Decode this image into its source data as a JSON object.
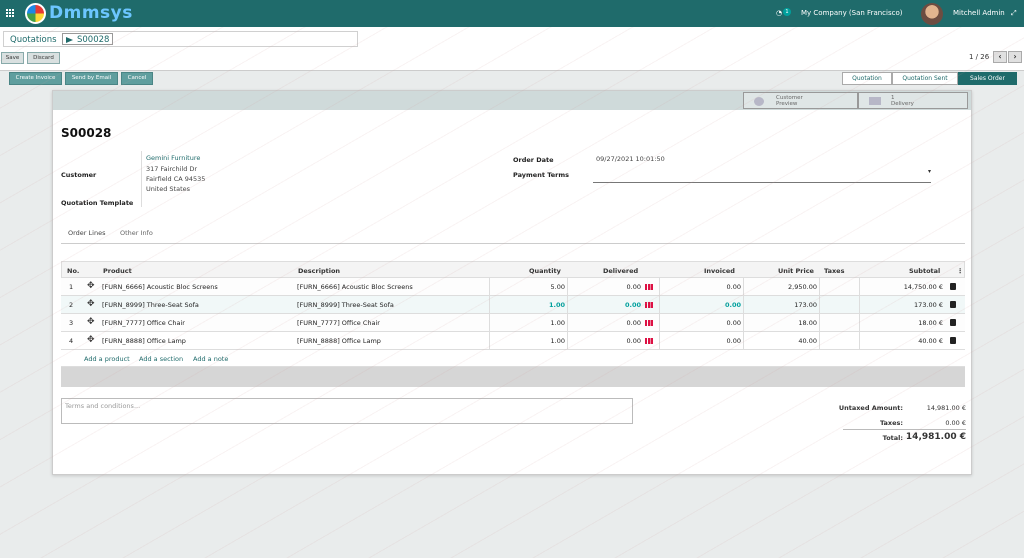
{
  "app": {
    "logo_text": "Dmmsys"
  },
  "topbar": {
    "chat_badge": "1",
    "company": "My Company (San Francisco)",
    "user": "Mitchell Admin",
    "expand_icon": "expand-icon"
  },
  "breadcrumb": {
    "parent": "Quotations",
    "current": "S00028"
  },
  "toolbar": {
    "save_label": "Save",
    "discard_label": "Discard"
  },
  "pager": {
    "text": "1 / 26"
  },
  "actions": {
    "create_invoice": "Create Invoice",
    "send_by_email": "Send by Email",
    "cancel": "Cancel"
  },
  "stages": [
    {
      "label": "Quotation",
      "active": false
    },
    {
      "label": "Quotation Sent",
      "active": false
    },
    {
      "label": "Sales Order",
      "active": true
    }
  ],
  "smart_buttons": [
    {
      "line1": "Customer",
      "line2": "Preview"
    },
    {
      "line1": "1",
      "line2": "Delivery"
    }
  ],
  "order": {
    "name": "S00028",
    "customer_label": "Customer",
    "customer_name": "Gemini Furniture",
    "address1": "317 Fairchild Dr",
    "address2": "Fairfield CA 94535",
    "address3": "United States",
    "quotation_template_label": "Quotation Template",
    "order_date_label": "Order Date",
    "order_date": "09/27/2021 10:01:50",
    "payment_terms_label": "Payment Terms"
  },
  "tabs": [
    "Order Lines",
    "Other Info"
  ],
  "table": {
    "headers": [
      "No.",
      "Product",
      "Description",
      "Quantity",
      "Delivered",
      "Invoiced",
      "Unit Price",
      "Taxes",
      "Subtotal"
    ],
    "rows": [
      {
        "no": "1",
        "product": "[FURN_6666] Acoustic Bloc Screens",
        "description": "[FURN_6666] Acoustic Bloc Screens",
        "quantity": "5.00",
        "delivered": "0.00",
        "invoiced": "0.00",
        "unit_price": "2,950.00",
        "subtotal": "14,750.00 €",
        "highlight": false
      },
      {
        "no": "2",
        "product": "[FURN_8999] Three-Seat Sofa",
        "description": "[FURN_8999] Three-Seat Sofa",
        "quantity": "1.00",
        "delivered": "0.00",
        "invoiced": "0.00",
        "unit_price": "173.00",
        "subtotal": "173.00 €",
        "highlight": true
      },
      {
        "no": "3",
        "product": "[FURN_7777] Office Chair",
        "description": "[FURN_7777] Office Chair",
        "quantity": "1.00",
        "delivered": "0.00",
        "invoiced": "0.00",
        "unit_price": "18.00",
        "subtotal": "18.00 €",
        "highlight": false
      },
      {
        "no": "4",
        "product": "[FURN_8888] Office Lamp",
        "description": "[FURN_8888] Office Lamp",
        "quantity": "1.00",
        "delivered": "0.00",
        "invoiced": "0.00",
        "unit_price": "40.00",
        "subtotal": "40.00 €",
        "highlight": false
      }
    ],
    "add_product": "Add a product",
    "add_section": "Add a section",
    "add_note": "Add a note"
  },
  "terms_placeholder": "Terms and conditions...",
  "totals": {
    "untaxed_label": "Untaxed Amount:",
    "untaxed": "14,981.00 €",
    "taxes_label": "Taxes:",
    "taxes": "0.00 €",
    "total_label": "Total:",
    "total": "14,981.00 €"
  }
}
